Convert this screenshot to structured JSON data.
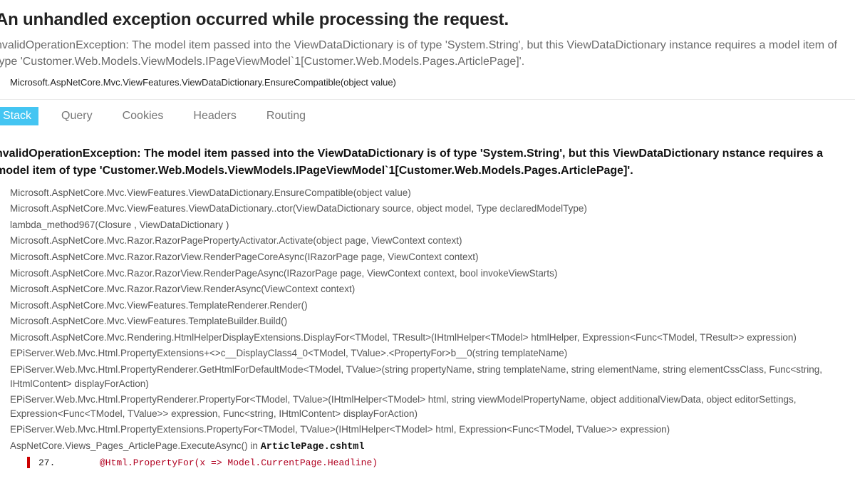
{
  "header": {
    "title": "An unhandled exception occurred while processing the request.",
    "summary": "nvalidOperationException: The model item passed into the ViewDataDictionary is of type 'System.String', but this ViewDataDictionary instance requires a model item of type 'Customer.Web.Models.ViewModels.IPageViewModel`1[Customer.Web.Models.Pages.ArticlePage]'.",
    "source": "Microsoft.AspNetCore.Mvc.ViewFeatures.ViewDataDictionary.EnsureCompatible(object value)"
  },
  "tabs": {
    "stack": "Stack",
    "query": "Query",
    "cookies": "Cookies",
    "headers": "Headers",
    "routing": "Routing"
  },
  "exception": {
    "heading": "nvalidOperationException: The model item passed into the ViewDataDictionary is of type 'System.String', but this ViewDataDictionary nstance requires a model item of type 'Customer.Web.Models.ViewModels.IPageViewModel`1[Customer.Web.Models.Pages.ArticlePage]'.",
    "frames": [
      "Microsoft.AspNetCore.Mvc.ViewFeatures.ViewDataDictionary.EnsureCompatible(object value)",
      "Microsoft.AspNetCore.Mvc.ViewFeatures.ViewDataDictionary..ctor(ViewDataDictionary source, object model, Type declaredModelType)",
      "lambda_method967(Closure , ViewDataDictionary )",
      "Microsoft.AspNetCore.Mvc.Razor.RazorPagePropertyActivator.Activate(object page, ViewContext context)",
      "Microsoft.AspNetCore.Mvc.Razor.RazorView.RenderPageCoreAsync(IRazorPage page, ViewContext context)",
      "Microsoft.AspNetCore.Mvc.Razor.RazorView.RenderPageAsync(IRazorPage page, ViewContext context, bool invokeViewStarts)",
      "Microsoft.AspNetCore.Mvc.Razor.RazorView.RenderAsync(ViewContext context)",
      "Microsoft.AspNetCore.Mvc.ViewFeatures.TemplateRenderer.Render()",
      "Microsoft.AspNetCore.Mvc.ViewFeatures.TemplateBuilder.Build()",
      "Microsoft.AspNetCore.Mvc.Rendering.HtmlHelperDisplayExtensions.DisplayFor<TModel, TResult>(IHtmlHelper<TModel> htmlHelper, Expression<Func<TModel, TResult>> expression)",
      "EPiServer.Web.Mvc.Html.PropertyExtensions+<>c__DisplayClass4_0<TModel, TValue>.<PropertyFor>b__0(string templateName)",
      "EPiServer.Web.Mvc.Html.PropertyRenderer.GetHtmlForDefaultMode<TModel, TValue>(string propertyName, string templateName, string elementName, string elementCssClass, Func<string, IHtmlContent> displayForAction)",
      "EPiServer.Web.Mvc.Html.PropertyRenderer.PropertyFor<TModel, TValue>(IHtmlHelper<TModel> html, string viewModelPropertyName, object additionalViewData, object editorSettings, Expression<Func<TModel, TValue>> expression, Func<string, IHtmlContent> displayForAction)",
      "EPiServer.Web.Mvc.Html.PropertyExtensions.PropertyFor<TModel, TValue>(IHtmlHelper<TModel> html, Expression<Func<TModel, TValue>> expression)"
    ],
    "lastFrame": {
      "prefix": "AspNetCore.Views_Pages_ArticlePage.ExecuteAsync() in ",
      "file": "ArticlePage.cshtml"
    },
    "code": {
      "line": "27.",
      "text": "@Html.PropertyFor(x => Model.CurrentPage.Headline)"
    }
  }
}
